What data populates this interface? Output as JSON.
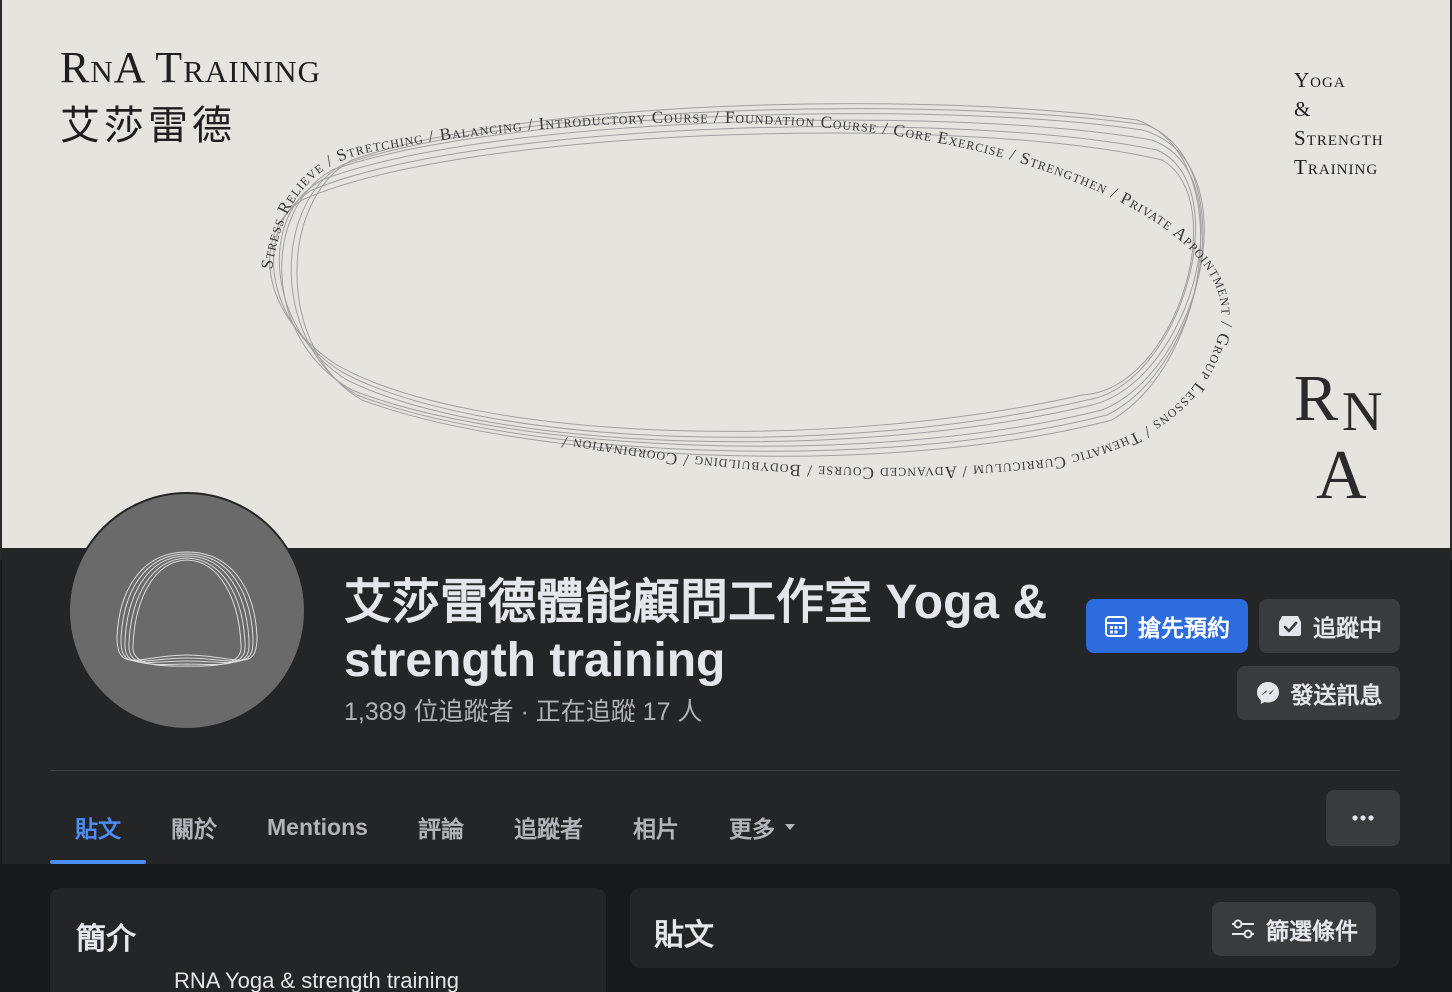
{
  "cover": {
    "brand_en": "RnA Training",
    "brand_zh": "艾莎雷德",
    "tagline": [
      "Yoga",
      "&",
      "Strength",
      "Training"
    ],
    "monogram": [
      "R",
      "N",
      "A"
    ],
    "ring_text": "Stress Relieve / Stretching / Balancing / Introductory Course / Foundation Course / Core Exercise / Strengthen / Private Appointment / Group Lessons / Thematic Curriculum / Advanced Course / Bodybuilding / Coordination / "
  },
  "page": {
    "title": "艾莎雷德體能顧問工作室 Yoga & strength training",
    "stats": "1,389 位追蹤者 · 正在追蹤 17 人"
  },
  "actions": {
    "book": "搶先預約",
    "following": "追蹤中",
    "message": "發送訊息"
  },
  "tabs": [
    {
      "label": "貼文",
      "active": true
    },
    {
      "label": "關於"
    },
    {
      "label": "Mentions"
    },
    {
      "label": "評論"
    },
    {
      "label": "追蹤者"
    },
    {
      "label": "相片"
    },
    {
      "label": "更多"
    }
  ],
  "intro": {
    "heading": "簡介",
    "text": "RNA Yoga & strength training"
  },
  "posts": {
    "heading": "貼文",
    "filter": "篩選條件"
  },
  "colors": {
    "accent": "#2d6cdf",
    "tab_active": "#4b8cf5",
    "cover_bg": "#e6e4df",
    "band_bg": "#242526"
  },
  "icons": {
    "book": "calendar-icon",
    "following": "check-inbox-icon",
    "message": "messenger-icon",
    "more_tab": "caret-down-icon",
    "more": "ellipsis-icon",
    "filter": "sliders-icon"
  }
}
